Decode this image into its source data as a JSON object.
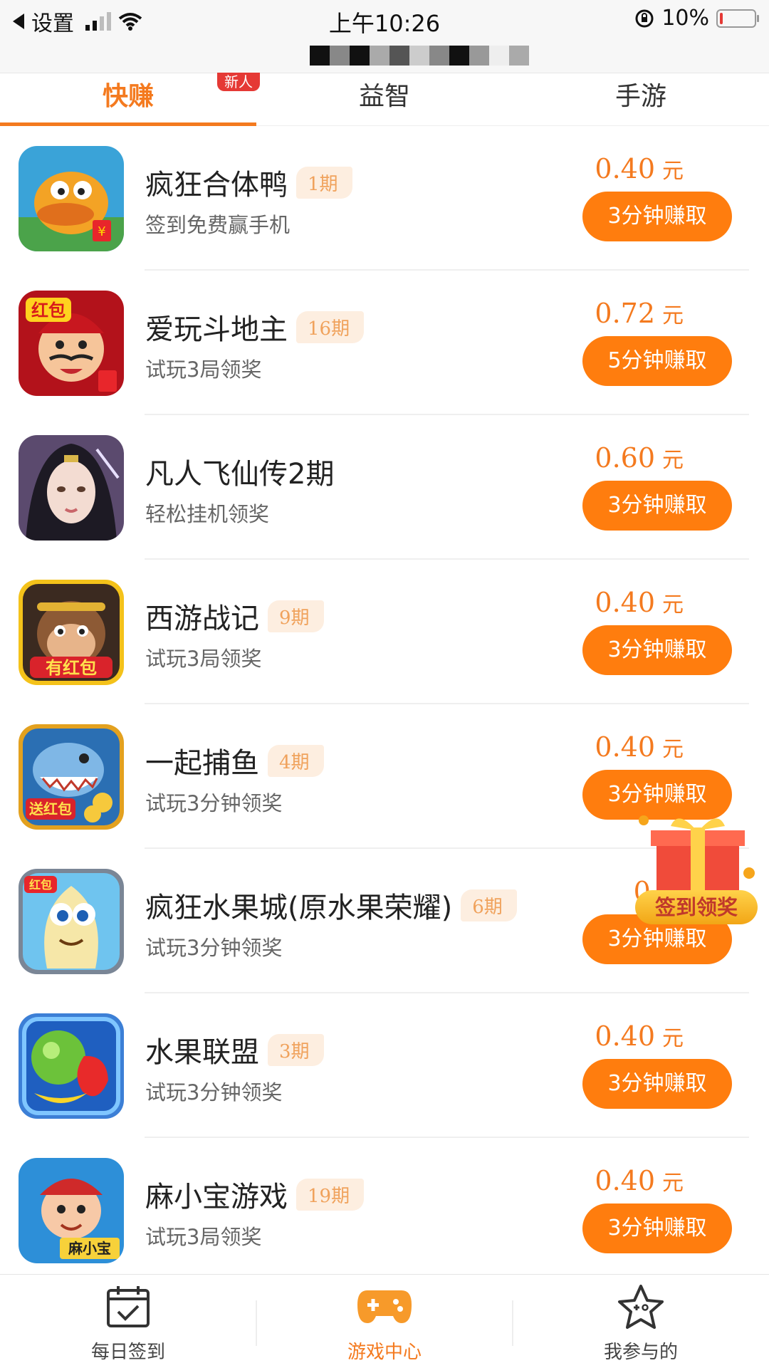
{
  "status_bar": {
    "back_label": "设置",
    "time": "上午10:26",
    "battery_pct": "10%",
    "battery_level": 0.1
  },
  "tabs": [
    {
      "label": "快赚",
      "active": true,
      "badge": "新人"
    },
    {
      "label": "益智",
      "active": false
    },
    {
      "label": "手游",
      "active": false
    }
  ],
  "games": [
    {
      "name": "疯狂合体鸭",
      "period": "1期",
      "desc": "签到免费赢手机",
      "price": "0.40",
      "unit": "元",
      "button": "3分钟赚取",
      "icon": "duck-icon"
    },
    {
      "name": "爱玩斗地主",
      "period": "16期",
      "desc": "试玩3局领奖",
      "price": "0.72",
      "unit": "元",
      "button": "5分钟赚取",
      "icon": "landlord-icon"
    },
    {
      "name": "凡人飞仙传2期",
      "period": "",
      "desc": "轻松挂机领奖",
      "price": "0.60",
      "unit": "元",
      "button": "3分钟赚取",
      "icon": "fairy-icon"
    },
    {
      "name": "西游战记",
      "period": "9期",
      "desc": "试玩3局领奖",
      "price": "0.40",
      "unit": "元",
      "button": "3分钟赚取",
      "icon": "monkey-icon"
    },
    {
      "name": "一起捕鱼",
      "period": "4期",
      "desc": "试玩3分钟领奖",
      "price": "0.40",
      "unit": "元",
      "button": "3分钟赚取",
      "icon": "shark-icon"
    },
    {
      "name": "疯狂水果城(原水果荣耀)",
      "period": "6期",
      "desc": "试玩3分钟领奖",
      "price": "0.4",
      "unit": "",
      "button": "3分钟赚取",
      "icon": "fruit-city-icon"
    },
    {
      "name": "水果联盟",
      "period": "3期",
      "desc": "试玩3分钟领奖",
      "price": "0.40",
      "unit": "元",
      "button": "3分钟赚取",
      "icon": "fruit-league-icon"
    },
    {
      "name": "麻小宝游戏",
      "period": "19期",
      "desc": "试玩3局领奖",
      "price": "0.40",
      "unit": "元",
      "button": "3分钟赚取",
      "icon": "mahjong-icon"
    }
  ],
  "float_gift": {
    "label": "签到领奖",
    "icon": "gift-icon"
  },
  "bottom_nav": [
    {
      "label": "每日签到",
      "icon": "calendar-check-icon",
      "active": false
    },
    {
      "label": "游戏中心",
      "icon": "gamepad-icon",
      "active": true
    },
    {
      "label": "我参与的",
      "icon": "star-icon",
      "active": false
    }
  ],
  "colors": {
    "accent": "#f47a1f",
    "button": "#ff7d0e",
    "period_bg": "#fdeee0"
  }
}
